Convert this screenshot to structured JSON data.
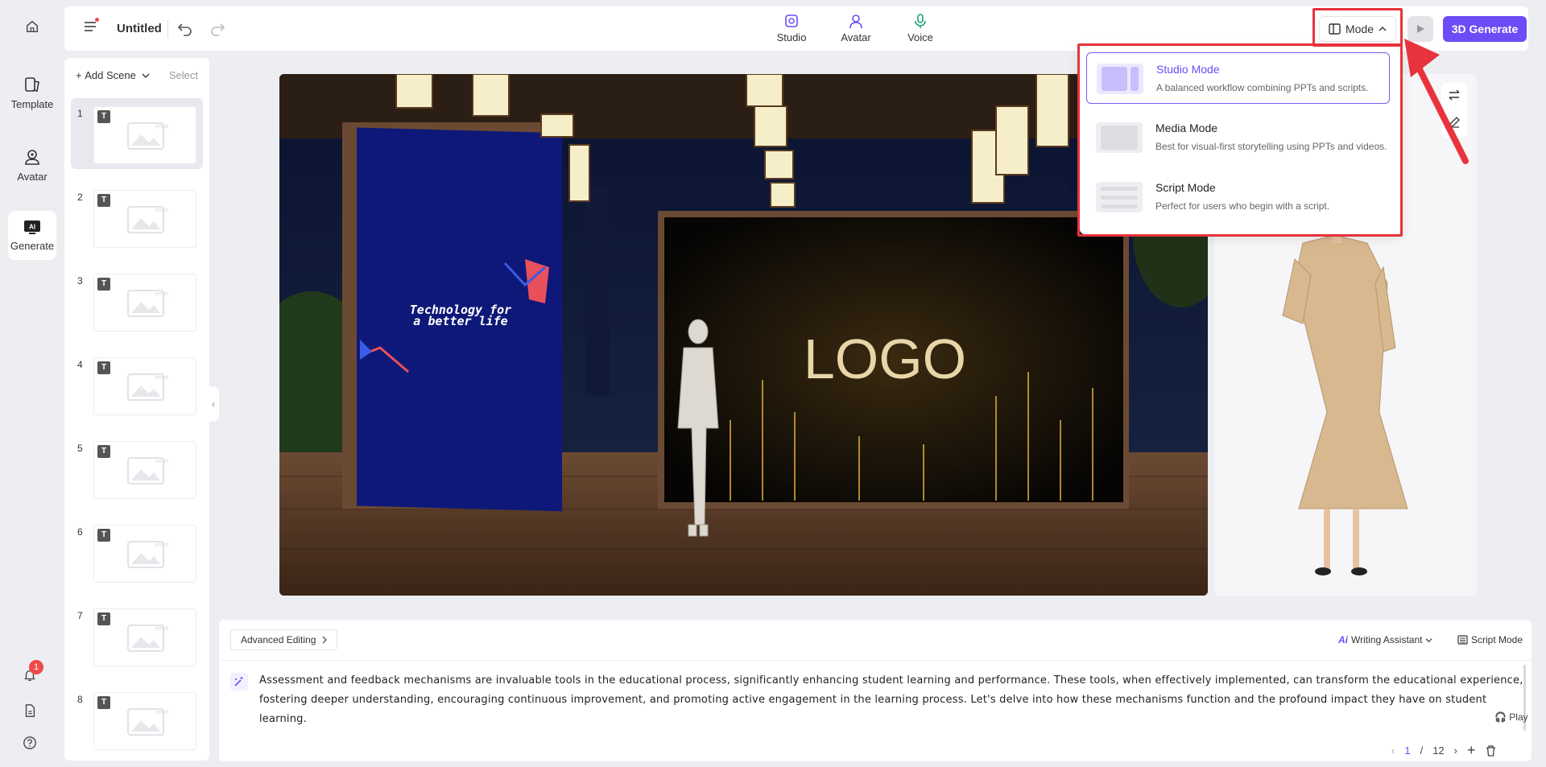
{
  "nav_rail": {
    "items": [
      {
        "name": "home",
        "label": ""
      },
      {
        "name": "template",
        "label": "Template"
      },
      {
        "name": "avatar",
        "label": "Avatar"
      },
      {
        "name": "generate",
        "label": "Generate"
      }
    ],
    "notification_count": "1"
  },
  "topbar": {
    "title": "Untitled",
    "tabs": [
      {
        "label": "Studio"
      },
      {
        "label": "Avatar"
      },
      {
        "label": "Voice"
      }
    ],
    "mode_label": "Mode",
    "generate_label": "3D Generate"
  },
  "scene_panel": {
    "add_label": "Add Scene",
    "select_label": "Select",
    "scenes": [
      {
        "num": "1",
        "tag": "T",
        "placeholder": "empty"
      },
      {
        "num": "2",
        "tag": "T",
        "placeholder": "empty"
      },
      {
        "num": "3",
        "tag": "T",
        "placeholder": "empty"
      },
      {
        "num": "4",
        "tag": "T",
        "placeholder": "empty"
      },
      {
        "num": "5",
        "tag": "T",
        "placeholder": "empty"
      },
      {
        "num": "6",
        "tag": "T",
        "placeholder": "empty"
      },
      {
        "num": "7",
        "tag": "T",
        "placeholder": "empty"
      },
      {
        "num": "8",
        "tag": "T",
        "placeholder": "empty"
      }
    ]
  },
  "canvas": {
    "banner_text": "Technology for a better life",
    "banner_line1": "Technology for",
    "banner_line2": "a better life",
    "logo_text": "LOGO"
  },
  "mode_menu": {
    "options": [
      {
        "title": "Studio Mode",
        "desc": "A balanced workflow combining PPTs and scripts.",
        "selected": true
      },
      {
        "title": "Media Mode",
        "desc": "Best for visual-first storytelling using PPTs and videos.",
        "selected": false
      },
      {
        "title": "Script Mode",
        "desc": "Perfect for users who begin with a script.",
        "selected": false
      }
    ]
  },
  "script_panel": {
    "advanced_editing": "Advanced Editing",
    "writing_assistant": "Writing Assistant",
    "script_mode": "Script Mode",
    "text": "Assessment and feedback mechanisms are invaluable tools in the educational process, significantly enhancing student learning and performance. These tools, when effectively implemented, can transform the educational experience, fostering deeper understanding, encouraging continuous improvement, and promoting active engagement in the learning process. Let's delve into how these mechanisms function and the profound impact they have on student learning.",
    "play_label": "Play",
    "page_current": "1",
    "page_sep": "/",
    "page_total": "12"
  },
  "colors": {
    "accent": "#6c4cf6",
    "highlight": "#e8323c",
    "banner_blue": "#0e1878"
  }
}
